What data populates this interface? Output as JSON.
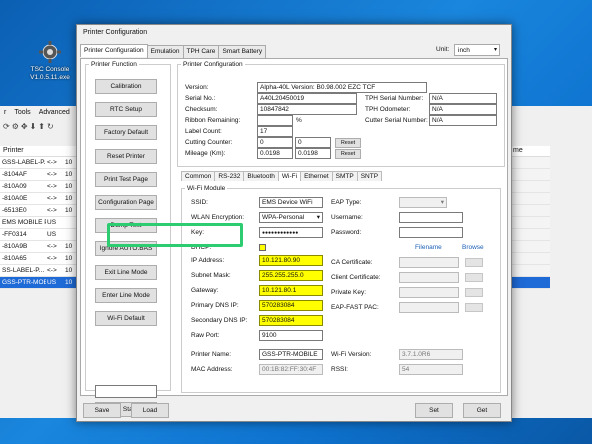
{
  "desktop_icon": {
    "line1": "TSC Console",
    "line2": "V1.0.5.11.exe"
  },
  "back_app": {
    "menu": [
      "r",
      "Tools",
      "Advanced"
    ],
    "column_header": "Printer",
    "right_header": "me",
    "rows": [
      {
        "name": "GSS-LABEL-P...",
        "type": "<->",
        "ip": "10",
        "selected": false
      },
      {
        "name": "-8104AF",
        "type": "<->",
        "ip": "10",
        "selected": false
      },
      {
        "name": "-810A09",
        "type": "<->",
        "ip": "10",
        "selected": false
      },
      {
        "name": "-810A0E",
        "type": "<->",
        "ip": "10",
        "selected": false
      },
      {
        "name": "-6513E0",
        "type": "<->",
        "ip": "10",
        "selected": false
      },
      {
        "name": "EMS MOBILE P...",
        "type": "US",
        "ip": "",
        "selected": false
      },
      {
        "name": "-FF0314",
        "type": "US",
        "ip": "",
        "selected": false
      },
      {
        "name": "-810A9B",
        "type": "<->",
        "ip": "10",
        "selected": false
      },
      {
        "name": "-810A65",
        "type": "<->",
        "ip": "10",
        "selected": false
      },
      {
        "name": "SS-LABEL-P...",
        "type": "<->",
        "ip": "10",
        "selected": false
      },
      {
        "name": "GSS-PTR-MOBI...",
        "type": "US",
        "ip": "10",
        "selected": true
      }
    ]
  },
  "dialog": {
    "title": "Printer Configuration",
    "tabs": [
      "Printer Configuration",
      "Emulation",
      "TPH Care",
      "Smart Battery"
    ],
    "unit_label": "Unit:",
    "unit_value": "inch",
    "printer_function": {
      "legend": "Printer Function",
      "buttons": [
        "Calibration",
        "RTC Setup",
        "Factory Default",
        "Reset Printer",
        "Print Test Page",
        "Configuration Page",
        "Dump Text",
        "Ignore AUTO.BAS",
        "Exit Line Mode",
        "Enter Line Mode",
        "Wi-Fi Default"
      ],
      "status_value": "",
      "get_status": "Get Status"
    },
    "printer_configuration": {
      "legend": "Printer Configuration",
      "version_label": "Version:",
      "version": "Alpha-40L Version: B0.98.002 EZC TCF",
      "serial_label": "Serial No.:",
      "serial": "A40L20450019",
      "checksum_label": "Checksum:",
      "checksum": "10847842",
      "ribbon_label": "Ribbon Remaining:",
      "ribbon": "",
      "ribbon_unit": "%",
      "label_count_label": "Label Count:",
      "label_count": "17",
      "cutting_label": "Cutting Counter:",
      "cutting_a": "0",
      "cutting_b": "0",
      "mileage_label": "Mileage (Km):",
      "mileage_a": "0.0198",
      "mileage_b": "0.0198",
      "reset": "Reset",
      "tph_serial_label": "TPH Serial Number:",
      "tph_serial": "N/A",
      "tph_odo_label": "TPH Odometer:",
      "tph_odo": "N/A",
      "cutter_serial_label": "Cutter Serial Number:",
      "cutter_serial": "N/A"
    },
    "subtabs": [
      "Common",
      "RS-232",
      "Bluetooth",
      "Wi-Fi",
      "Ethernet",
      "SMTP",
      "SNTP"
    ],
    "wifi": {
      "legend": "Wi-Fi Module",
      "ssid_label": "SSID:",
      "ssid": "EMS Device WiFi",
      "wlan_label": "WLAN Encryption:",
      "wlan": "WPA-Personal",
      "key_label": "Key:",
      "key": "●●●●●●●●●●●●",
      "dhcp_label": "DHCP:",
      "ip_label": "IP Address:",
      "ip": "10.121.80.90",
      "subnet_label": "Subnet Mask:",
      "subnet": "255.255.255.0",
      "gateway_label": "Gateway:",
      "gateway": "10.121.80.1",
      "dns1_label": "Primary DNS IP:",
      "dns1": "570283084",
      "dns2_label": "Secondary DNS IP:",
      "dns2": "570283084",
      "raw_port_label": "Raw Port:",
      "raw_port": "9100",
      "printer_name_label": "Printer Name:",
      "printer_name": "GSS-PTR-MOBILE",
      "mac_label": "MAC Address:",
      "mac": "00:1B:82:FF:30:4F",
      "eap_type_label": "EAP Type:",
      "username_label": "Username:",
      "password_label": "Password:",
      "filename_header": "Filename",
      "browse_header": "Browse",
      "ca_label": "CA Certificate:",
      "client_label": "Client Certificate:",
      "private_label": "Private Key:",
      "pac_label": "EAP-FAST PAC:",
      "wifi_version_label": "Wi-Fi Version:",
      "wifi_version": "3.7.1.0R6",
      "rssi_label": "RSSI:",
      "rssi": "54"
    },
    "footer": {
      "save": "Save",
      "load": "Load",
      "set": "Set",
      "get": "Get"
    }
  },
  "colors": {
    "highlight": "#2ecc71",
    "field_yellow": "#ffff00",
    "selected_row": "#1e6ad6"
  }
}
